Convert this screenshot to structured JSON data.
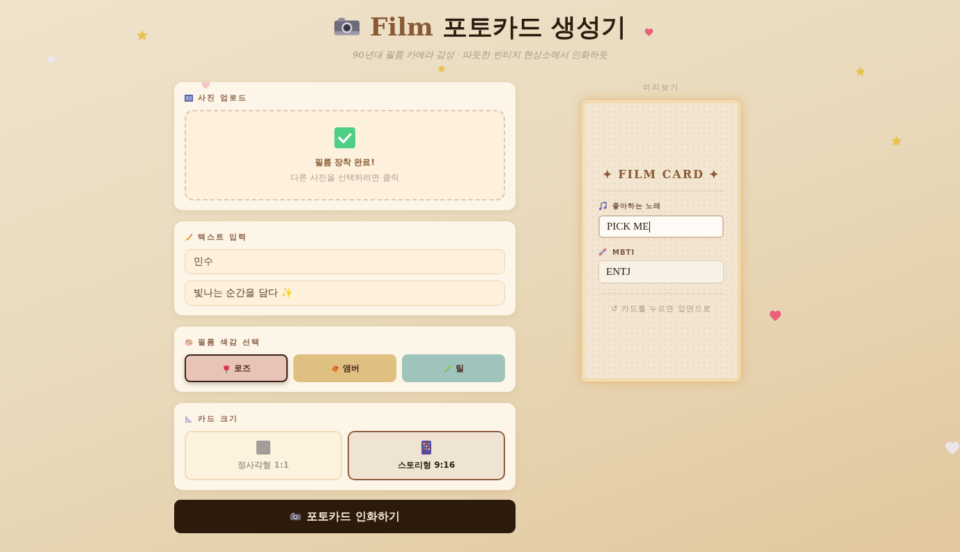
{
  "header": {
    "title_latin": "Film",
    "title_korean": "포토카드 생성기",
    "subtitle": "90년대 필름 카메라 감성 · 따뜻한 빈티지 현상소에서 인화하듯"
  },
  "upload": {
    "heading": "사진 업로드",
    "uploaded": true,
    "status": "필름 장착 완료!",
    "hint": "다른 사진을 선택하려면 클릭"
  },
  "text_input": {
    "heading": "텍스트 입력",
    "fields": [
      {
        "value": "민수"
      },
      {
        "value": "빛나는 순간을 담다 ✨"
      }
    ]
  },
  "tone": {
    "heading": "필름 색감 선택",
    "options": [
      {
        "label": "로즈",
        "color": "#e8c4b8",
        "selected": true
      },
      {
        "label": "앰버",
        "color": "#e0c080",
        "selected": false
      },
      {
        "label": "틸",
        "color": "#9fc4bc",
        "selected": false
      }
    ]
  },
  "size": {
    "heading": "카드 크기",
    "options": [
      {
        "label": "정사각형 1:1",
        "selected": false
      },
      {
        "label": "스토리형 9:16",
        "selected": true
      }
    ]
  },
  "print_button": "포토카드 인화하기",
  "preview": {
    "label": "미리보기",
    "card": {
      "title": "✦ FILM CARD ✦",
      "fields": [
        {
          "label": "좋아하는 노래",
          "value": "PICK ME",
          "focused": true
        },
        {
          "label": "MBTI",
          "value": "ENTJ",
          "focused": false
        }
      ],
      "hint": "↺ 카드를 누르면 앞면으로"
    }
  }
}
